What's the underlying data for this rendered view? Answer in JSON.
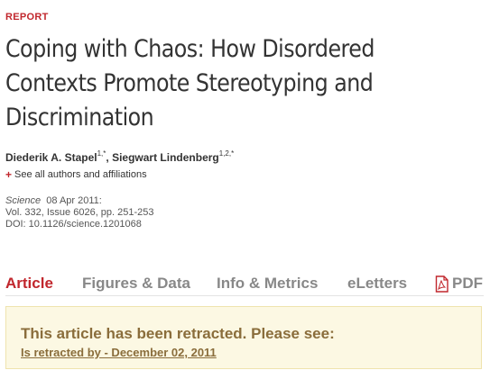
{
  "section_label": "REPORT",
  "article": {
    "title_lines": [
      "Coping with Chaos: How Disordered",
      "Contexts Promote Stereotyping and",
      "Discrimination"
    ],
    "authors": [
      {
        "name": "Diederik A. Stapel",
        "sup": "1,*"
      },
      {
        "name": "Siegwart Lindenberg",
        "sup": "1,2,*"
      }
    ],
    "author_separator": ", ",
    "see_all_prefix": "+",
    "see_all_label": "See all authors and affiliations",
    "journal": "Science",
    "date": "08 Apr 2011:",
    "volume_line": "Vol. 332, Issue 6026, pp. 251-253",
    "doi_line": "DOI: 10.1126/science.1201068"
  },
  "tabs": [
    {
      "label": "Article",
      "active": true
    },
    {
      "label": "Figures & Data",
      "active": false
    },
    {
      "label": "Info & Metrics",
      "active": false
    },
    {
      "label": "eLetters",
      "active": false
    }
  ],
  "pdf_tab": {
    "label": "PDF",
    "icon": "pdf-file-icon"
  },
  "retraction": {
    "message": "This article has been retracted. Please see:",
    "link_text": "Is retracted by - December 02, 2011"
  },
  "colors": {
    "accent": "#c1272d",
    "retraction_bg": "#fcf8e3",
    "retraction_text": "#8a6d3b"
  }
}
